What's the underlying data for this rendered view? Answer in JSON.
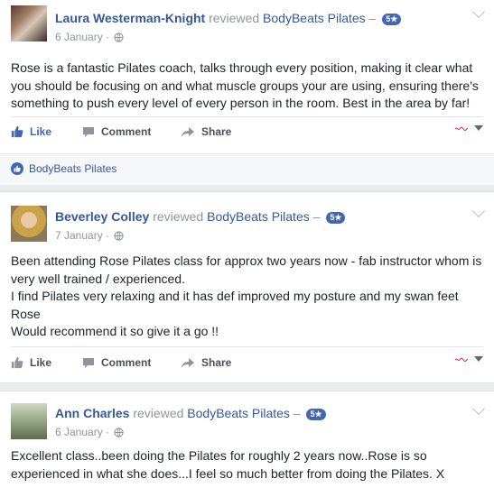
{
  "reviews": [
    {
      "author": "Laura Westerman-Knight",
      "reviewed_word": "reviewed",
      "page": "BodyBeats Pilates",
      "dash": "–",
      "rating": "5★",
      "date": "6 January ·",
      "text": "Rose is a fantastic Pilates coach, talks through every position, making it clear what you should be focusing on and what muscle groups your are using, ensuring there's something to push every level of every person in the room. Best in the area by far!"
    },
    {
      "author": "Beverley Colley",
      "reviewed_word": "reviewed",
      "page": "BodyBeats Pilates",
      "dash": "–",
      "rating": "5★",
      "date": "7 January ·",
      "text_lines": [
        "Been attending Rose Pilates class for approx two years now - fab instructor whom is very well trained / experienced.",
        "I find Pilates very relaxing and it has def improved my posture and my swan feet Rose",
        "Would recommend it so give it a go !!"
      ]
    },
    {
      "author": "Ann Charles",
      "reviewed_word": "reviewed",
      "page": "BodyBeats Pilates",
      "dash": "–",
      "rating": "5★",
      "date": "6 January ·",
      "text": "Excellent class..been doing the Pilates for roughly 2 years now..Rose is so experienced in what she does...I feel so much better from doing the Pilates. X"
    }
  ],
  "actions": {
    "like": "Like",
    "comment": "Comment",
    "share": "Share"
  },
  "likes_row": {
    "text": "BodyBeats Pilates"
  },
  "colors": {
    "link": "#365899",
    "accent": "#4267b2",
    "muted": "#90949c"
  }
}
